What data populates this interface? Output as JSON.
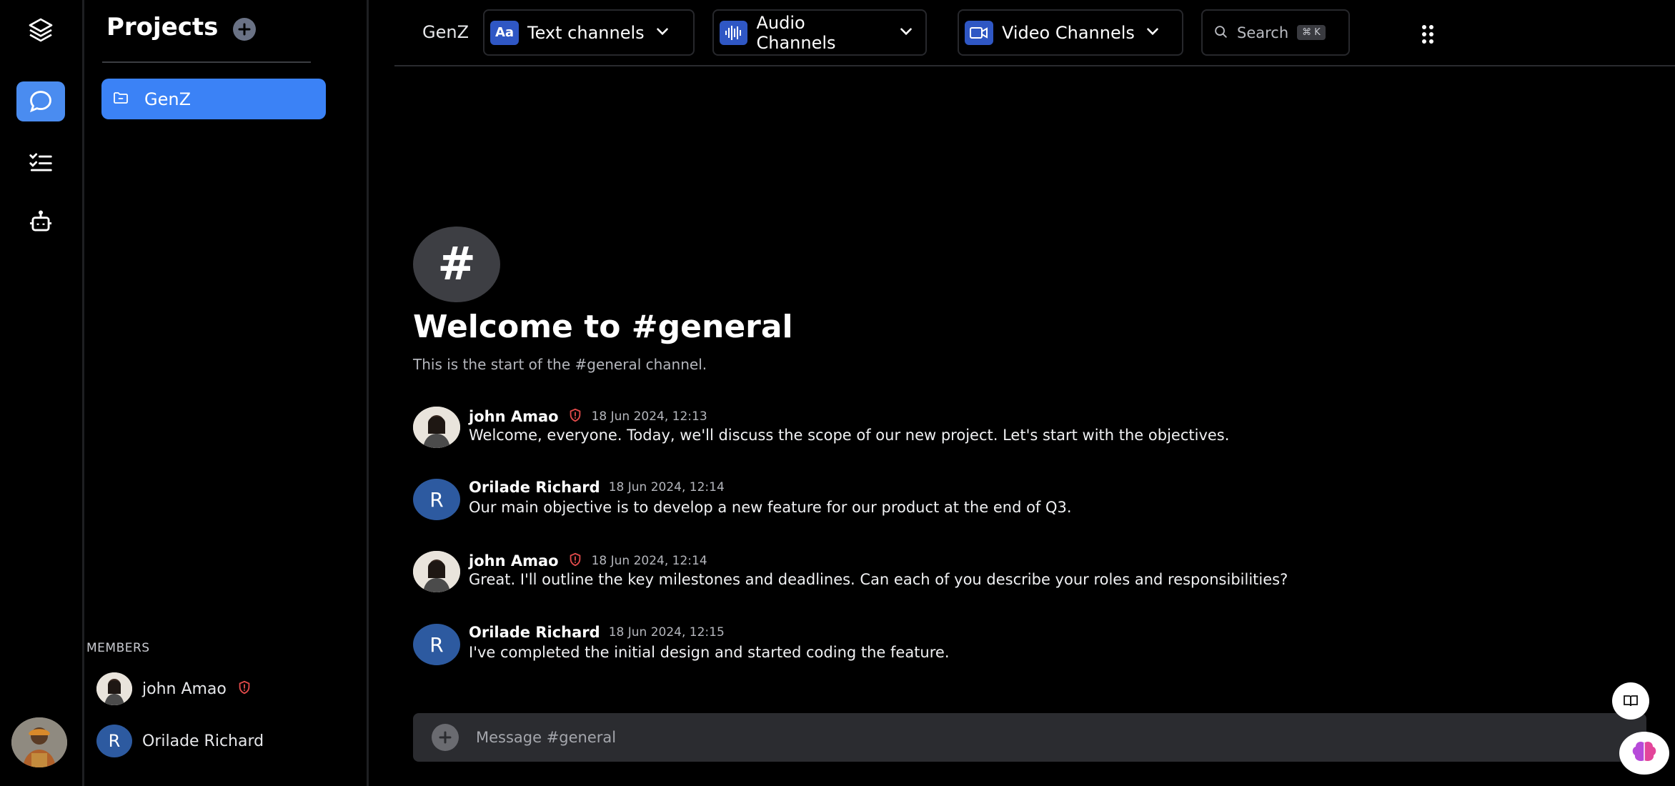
{
  "rail": {
    "icons": [
      "layers-icon",
      "chat-icon",
      "tasks-icon",
      "bot-icon"
    ],
    "accent": "#4a8cf0"
  },
  "projects": {
    "title": "Projects",
    "items": [
      {
        "label": "GenZ",
        "active": true
      }
    ],
    "members_header": "MEMBERS",
    "members": [
      {
        "name": "john Amao",
        "badge": "shield-icon"
      },
      {
        "name": "Orilade Richard",
        "initial": "R"
      }
    ]
  },
  "topbar": {
    "project": "GenZ",
    "text_channels": "Text channels",
    "audio_channels": "Audio Channels",
    "video_channels": "Video Channels",
    "search_label": "Search",
    "search_shortcut": "⌘ K"
  },
  "channel": {
    "hash": "#",
    "welcome": "Welcome to #general",
    "subtitle": "This is the start of the #general channel."
  },
  "messages": [
    {
      "author": "john Amao",
      "time": "18 Jun 2024, 12:13",
      "text": "Welcome, everyone. Today, we'll discuss the scope of our new project. Let's start with the objectives."
    },
    {
      "author": "Orilade Richard",
      "initial": "R",
      "time": "18 Jun 2024, 12:14",
      "text": "Our main objective is to develop a new feature for our product at the end of Q3."
    },
    {
      "author": "john Amao",
      "time": "18 Jun 2024, 12:14",
      "text": "Great. I'll outline the key milestones and deadlines. Can each of you describe your roles and responsibilities?"
    },
    {
      "author": "Orilade Richard",
      "initial": "R",
      "time": "18 Jun 2024, 12:15",
      "text": "I've completed the initial design and started coding the feature."
    }
  ],
  "composer": {
    "placeholder": "Message #general"
  },
  "colors": {
    "background": "#000000",
    "accent": "#3b82f6",
    "avatar_blue": "#2d5aa0",
    "admin_red": "#e04a4a"
  }
}
